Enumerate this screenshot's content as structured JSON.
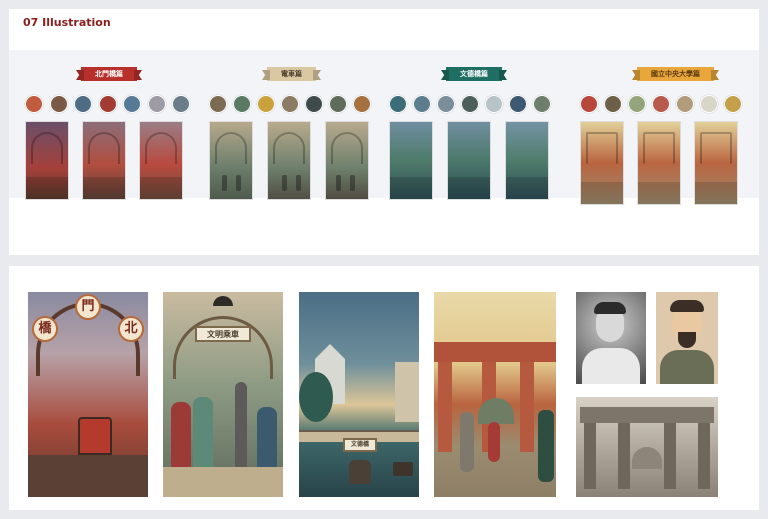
{
  "title": "07 Illustration",
  "banners": [
    {
      "text": "北門橋篇",
      "color": "#b8302c"
    },
    {
      "text": "電車篇",
      "color": "#d9c8a1"
    },
    {
      "text": "文德橋篇",
      "color": "#1f6e63"
    },
    {
      "text": "國立中央大學篇",
      "color": "#e8a63b"
    }
  ],
  "signs": {
    "bridge_chars": [
      "門",
      "橋",
      "北"
    ],
    "tram_sign": "文明乘車",
    "bridge_sign": "文德橋"
  }
}
